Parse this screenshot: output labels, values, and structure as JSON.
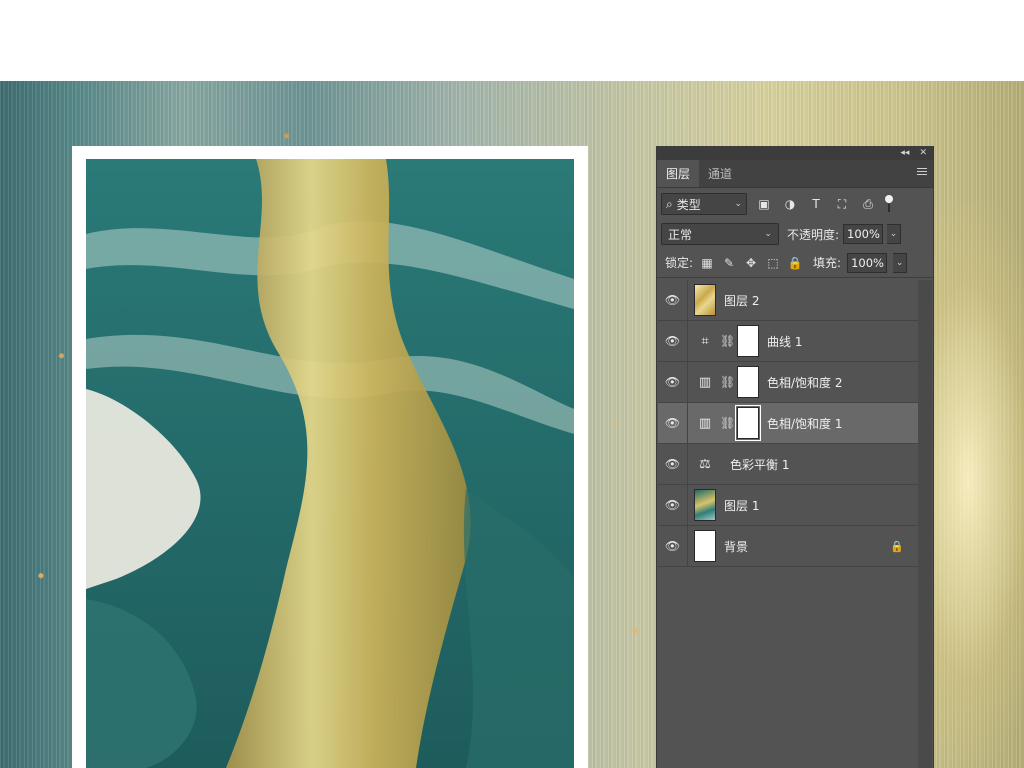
{
  "panel": {
    "titlebar_icons": [
      "collapse-icon",
      "close-icon"
    ],
    "titlebar_collapse": "◂◂",
    "titlebar_close": "✕",
    "tabs": [
      {
        "label": "图层",
        "active": true
      },
      {
        "label": "通道",
        "active": false
      }
    ],
    "filter": {
      "type_label": "类型",
      "icons": [
        "image-filter-icon",
        "adjustment-filter-icon",
        "type-filter-icon",
        "shape-filter-icon",
        "smart-object-filter-icon"
      ],
      "icon_glyphs": [
        "▣",
        "◑",
        "T",
        "⛶",
        "⎙"
      ]
    },
    "blend": {
      "mode": "正常",
      "opacity_label": "不透明度:",
      "opacity_value": "100%"
    },
    "lock": {
      "label": "锁定:",
      "icons": [
        "lock-transparent-icon",
        "lock-pixels-icon",
        "lock-position-icon",
        "lock-artboard-icon",
        "lock-all-icon"
      ],
      "icon_glyphs": [
        "▦",
        "✎",
        "✥",
        "⬚",
        "🔒"
      ],
      "fill_label": "填充:",
      "fill_value": "100%"
    },
    "layers": [
      {
        "name": "图层 2",
        "kind": "pixel",
        "thumb": "gold",
        "selected": false
      },
      {
        "name": "曲线 1",
        "kind": "adjustment",
        "icon": "curves-icon",
        "glyph": "⌗",
        "selected": false
      },
      {
        "name": "色相/饱和度 2",
        "kind": "adjustment",
        "icon": "hue-saturation-icon",
        "glyph": "▥",
        "selected": false
      },
      {
        "name": "色相/饱和度 1",
        "kind": "adjustment",
        "icon": "hue-saturation-icon",
        "glyph": "▥",
        "selected": true
      },
      {
        "name": "色彩平衡 1",
        "kind": "adjustment-nomask",
        "icon": "color-balance-icon",
        "glyph": "⚖",
        "selected": false
      },
      {
        "name": "图层 1",
        "kind": "pixel",
        "thumb": "teal",
        "selected": false
      },
      {
        "name": "背景",
        "kind": "background",
        "thumb": "white",
        "locked": true,
        "selected": false
      }
    ],
    "eye_glyph": "👁",
    "chain_glyph": "⛓",
    "lock_glyph": "🔒",
    "chevron_glyph": "⌄"
  },
  "colors": {
    "panel_bg": "#535353",
    "selected_row": "#696969",
    "tab_bar": "#424242"
  }
}
